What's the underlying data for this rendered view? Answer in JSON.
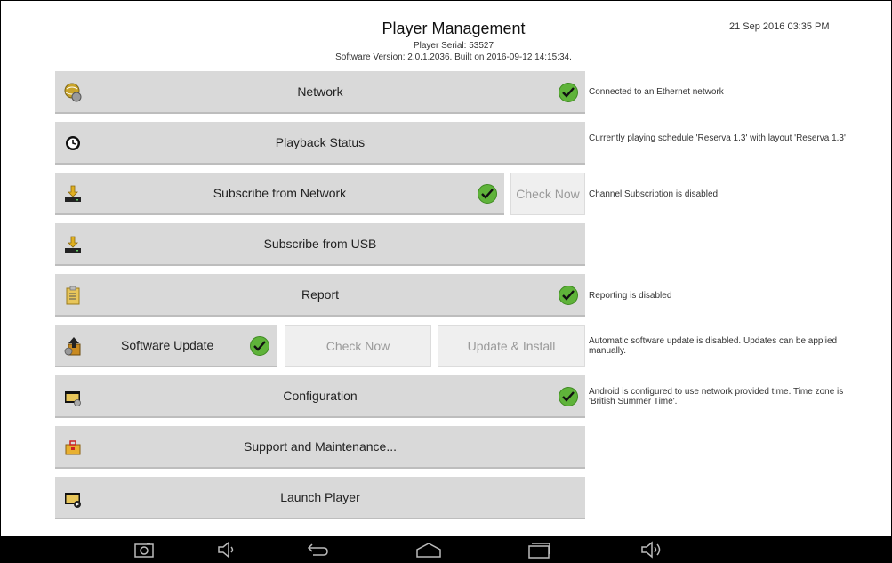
{
  "header": {
    "title": "Player Management",
    "serial": "Player Serial: 53527",
    "version": "Software Version: 2.0.1.2036.  Built on 2016-09-12 14:15:34.",
    "datetime": "21 Sep 2016 03:35 PM"
  },
  "rows": {
    "network": {
      "label": "Network",
      "desc": "Connected to an Ethernet network"
    },
    "playback": {
      "label": "Playback Status",
      "desc": "Currently playing schedule 'Reserva 1.3' with layout 'Reserva 1.3'"
    },
    "subscribe_net": {
      "label": "Subscribe from Network",
      "check_now": "Check Now",
      "desc": "Channel Subscription is disabled."
    },
    "subscribe_usb": {
      "label": "Subscribe from USB"
    },
    "report": {
      "label": "Report",
      "desc": "Reporting is disabled"
    },
    "software": {
      "label": "Software Update",
      "check_now": "Check Now",
      "update_install": "Update & Install",
      "desc": "Automatic software update is disabled.  Updates can be applied manually."
    },
    "configuration": {
      "label": "Configuration",
      "desc": "Android is configured to use network provided time.  Time zone is 'British Summer Time'."
    },
    "support": {
      "label": "Support and Maintenance..."
    },
    "launch": {
      "label": "Launch Player"
    }
  },
  "icons": {
    "network": "network-globe-icon",
    "playback": "clock-icon",
    "subscribe": "download-icon",
    "report": "clipboard-icon",
    "software": "upload-arrow-icon",
    "configuration": "folder-settings-icon",
    "support": "toolbox-icon",
    "launch": "play-icon",
    "check": "checkmark-icon"
  },
  "colors": {
    "button": "#d9d9d9",
    "button_disabled": "#efefef",
    "check": "#5fb33a",
    "navbar": "#000000"
  },
  "navbar": [
    "screenshot-icon",
    "volume-down-icon",
    "back-icon",
    "home-icon",
    "recents-icon",
    "volume-up-icon"
  ]
}
